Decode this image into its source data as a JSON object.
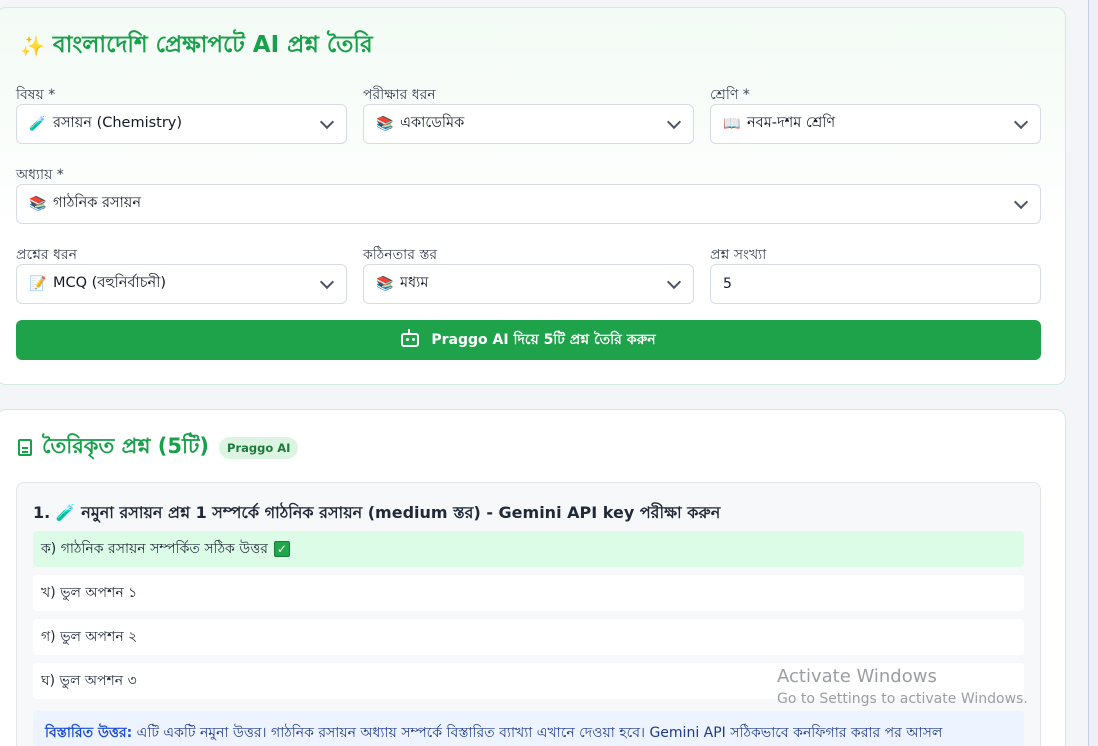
{
  "generator": {
    "title": "বাংলাদেশি প্রেক্ষাপটে AI প্রশ্ন তৈরি",
    "subject": {
      "label": "বিষয় *",
      "value": "রসায়ন (Chemistry)",
      "icon": "🧪"
    },
    "exam_type": {
      "label": "পরীক্ষার ধরন",
      "value": "একাডেমিক",
      "icon": "📚"
    },
    "class": {
      "label": "শ্রেণি *",
      "value": "নবম-দশম শ্রেণি",
      "icon": "📖"
    },
    "chapter": {
      "label": "অধ্যায় *",
      "value": "গাঠনিক রসায়ন",
      "icon": "📚"
    },
    "question_type": {
      "label": "প্রশ্নের ধরন",
      "value": "MCQ (বহুনির্বাচনী)",
      "icon": "📝"
    },
    "difficulty": {
      "label": "কঠিনতার স্তর",
      "value": "মধ্যম",
      "icon": "📚"
    },
    "count": {
      "label": "প্রশ্ন সংখ্যা",
      "value": "5"
    },
    "generate_button": "Praggo AI দিয়ে 5টি প্রশ্ন তৈরি করুন"
  },
  "results": {
    "title": "তৈরিকৃত প্রশ্ন (5টি)",
    "badge": "Praggo AI",
    "question": "1. 🧪 নমুনা রসায়ন প্রশ্ন 1 সম্পর্কে গাঠনিক রসায়ন (medium স্তর) - Gemini API key পরীক্ষা করুন",
    "options": [
      {
        "text": "ক) গাঠনিক রসায়ন সম্পর্কিত সঠিক উত্তর",
        "correct": true
      },
      {
        "text": "খ) ভুল অপশন ১",
        "correct": false
      },
      {
        "text": "গ) ভুল অপশন ২",
        "correct": false
      },
      {
        "text": "ঘ) ভুল অপশন ৩",
        "correct": false
      }
    ],
    "explanation_label": "বিস্তারিত উত্তর:",
    "explanation_text": " এটি একটি নমুনা উত্তর। গাঠনিক রসায়ন অধ্যায় সম্পর্কে বিস্তারিত ব্যাখ্যা এখানে দেওয়া হবে। Gemini API সঠিকভাবে কনফিগার করার পর আসল"
  },
  "watermark": {
    "line1": "Activate Windows",
    "line2": "Go to Settings to activate Windows."
  },
  "colors": {
    "primary": "#1ea34b",
    "correct_bg": "#dcfce7",
    "explain_bg": "#eef4ff"
  }
}
